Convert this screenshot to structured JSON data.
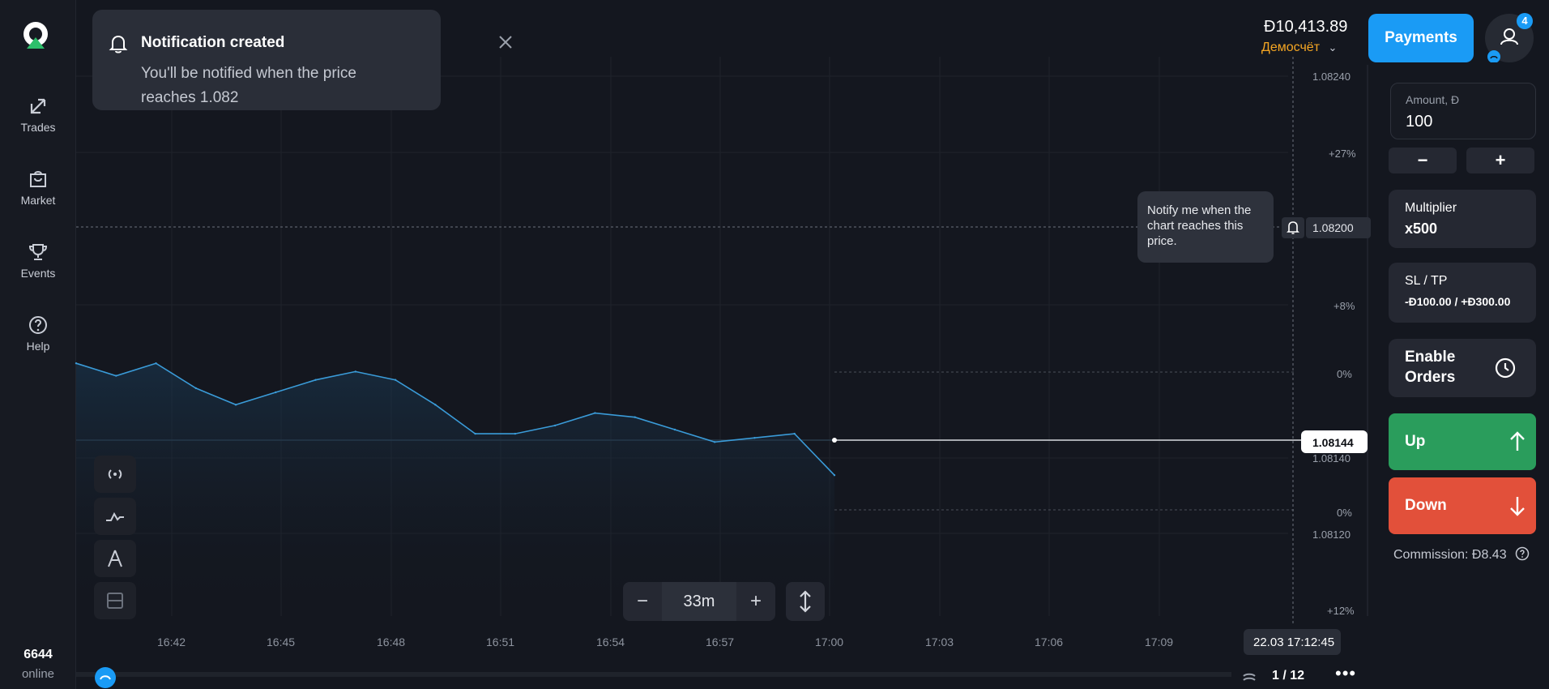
{
  "sidebar": {
    "items": [
      {
        "label": "Trades",
        "icon": "trades-icon"
      },
      {
        "label": "Market",
        "icon": "market-icon"
      },
      {
        "label": "Events",
        "icon": "trophy-icon"
      },
      {
        "label": "Help",
        "icon": "help-icon"
      }
    ],
    "online_count": "6644",
    "online_label": "online"
  },
  "header": {
    "balance": "Đ10,413.89",
    "account": "Демосчёт",
    "payments_label": "Payments",
    "notification_count": "4"
  },
  "toast": {
    "title": "Notification created",
    "body": "You'll be notified when the price reaches 1.082"
  },
  "chart": {
    "tooltip": "Notify me when the chart reaches this price.",
    "alert_price": "1.08200",
    "current_price": "1.08144",
    "top_price": "1.08240",
    "price_140": "1.08140",
    "price_120": "1.08120",
    "pct_top": "+27%",
    "pct_8": "+8%",
    "pct_0a": "0%",
    "pct_0b": "0%",
    "pct_bottom": "+12%",
    "time_badge": "22.03 17:12:45",
    "zoom_value": "33m",
    "zoom_minus": "−",
    "zoom_plus": "+",
    "page": "1 / 12",
    "more": "•••"
  },
  "chart_data": {
    "type": "line",
    "x": [
      "16:41",
      "16:42",
      "16:43",
      "16:44",
      "16:45",
      "16:46",
      "16:47",
      "16:48",
      "16:49",
      "16:50",
      "16:51",
      "16:52",
      "16:53",
      "16:54",
      "16:55",
      "16:56",
      "16:57",
      "16:58",
      "16:59",
      "17:00"
    ],
    "values": [
      1.08171,
      1.08168,
      1.08171,
      1.08165,
      1.08161,
      1.08164,
      1.08167,
      1.08169,
      1.08167,
      1.08161,
      1.08154,
      1.08154,
      1.08156,
      1.08159,
      1.08158,
      1.08155,
      1.08152,
      1.08153,
      1.08154,
      1.08144
    ],
    "x_ticks": [
      "16:42",
      "16:45",
      "16:48",
      "16:51",
      "16:54",
      "16:57",
      "17:00",
      "17:03",
      "17:06",
      "17:09"
    ],
    "y_ticks": [
      "1.08240",
      "1.08200",
      "1.08140",
      "1.08120"
    ],
    "ylim": [
      1.0811,
      1.08245
    ],
    "grid": true,
    "accent": "#3a9bd8"
  },
  "panel": {
    "amount_label": "Amount, Đ",
    "amount_value": "100",
    "minus": "−",
    "plus": "+",
    "multiplier_label": "Multiplier",
    "multiplier_value": "x500",
    "sltp_label": "SL / TP",
    "sltp_value": "-Đ100.00 / +Đ300.00",
    "orders_label": "Enable Orders",
    "up_label": "Up",
    "down_label": "Down",
    "commission": "Commission: Đ8.43",
    "up_color": "#2a9d5c",
    "down_color": "#e2503a"
  }
}
